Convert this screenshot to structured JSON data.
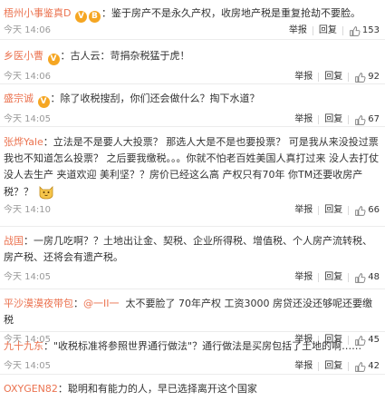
{
  "colors": {
    "username": "#eb7350",
    "text": "#333333",
    "time": "#999999",
    "badge": "#f5a623"
  },
  "labels": {
    "report": "举报",
    "reply": "回复"
  },
  "comments": [
    {
      "user": "梧州小事鉴真D",
      "badges": [
        "V",
        "B"
      ],
      "text": "鉴于房产不是永久产权，收房地产税是重复抢劫不要脸。",
      "time": "今天 14:06",
      "likes": "153",
      "action_icon": "thumbs-up-icon"
    },
    {
      "user": "乡医小曹",
      "badges": [
        "V"
      ],
      "text": "古人云：苛捐杂税猛于虎！",
      "time": "今天 14:06",
      "likes": "92"
    },
    {
      "user": "盛宗诚",
      "badges": [
        "V"
      ],
      "text": "除了收税搜刮，你们还会做什么？掏下水道？",
      "time": "今天 14:05",
      "likes": "67"
    },
    {
      "user": "张烨Yale",
      "badges": [],
      "text": "立法是不是要人大投票？ 那选人大是不是也要投票？ 可是我从来没投过票我也不知道怎么投票？ 之后要我缴税。。。你就不怕老百姓美国人真打过来 没人去打仗 没人去生产 夹道欢迎 美利坚？？房价已经这么高 产权只有70年 你TM还要收房产税？？",
      "time": "今天 14:10",
      "likes": "66"
    },
    {
      "user": "战国",
      "badges": [],
      "text": "一房几吃啊？？土地出让金、契税、企业所得税、增值税、个人房产流转税、房产税、还将会有遗产税。",
      "time": "今天 14:05",
      "likes": "48"
    },
    {
      "user": "平沙漠漠夜带包",
      "badges": [],
      "mention": "@一II一",
      "text": "太不要脸了 70年产权 工资3000 房贷还没还够呢还要缴税",
      "time": "今天 14:05",
      "likes": "45"
    },
    {
      "user": "九十九东",
      "badges": [],
      "text": "\"收税标准将参照世界通行做法\"？通行做法是买房包括了土地的啊……",
      "time": "今天 14:05",
      "likes": "42"
    },
    {
      "user": "OXYGEN82",
      "badges": [],
      "text": "聪明和有能力的人，早已选择离开这个国家",
      "time": "",
      "likes": ""
    }
  ]
}
